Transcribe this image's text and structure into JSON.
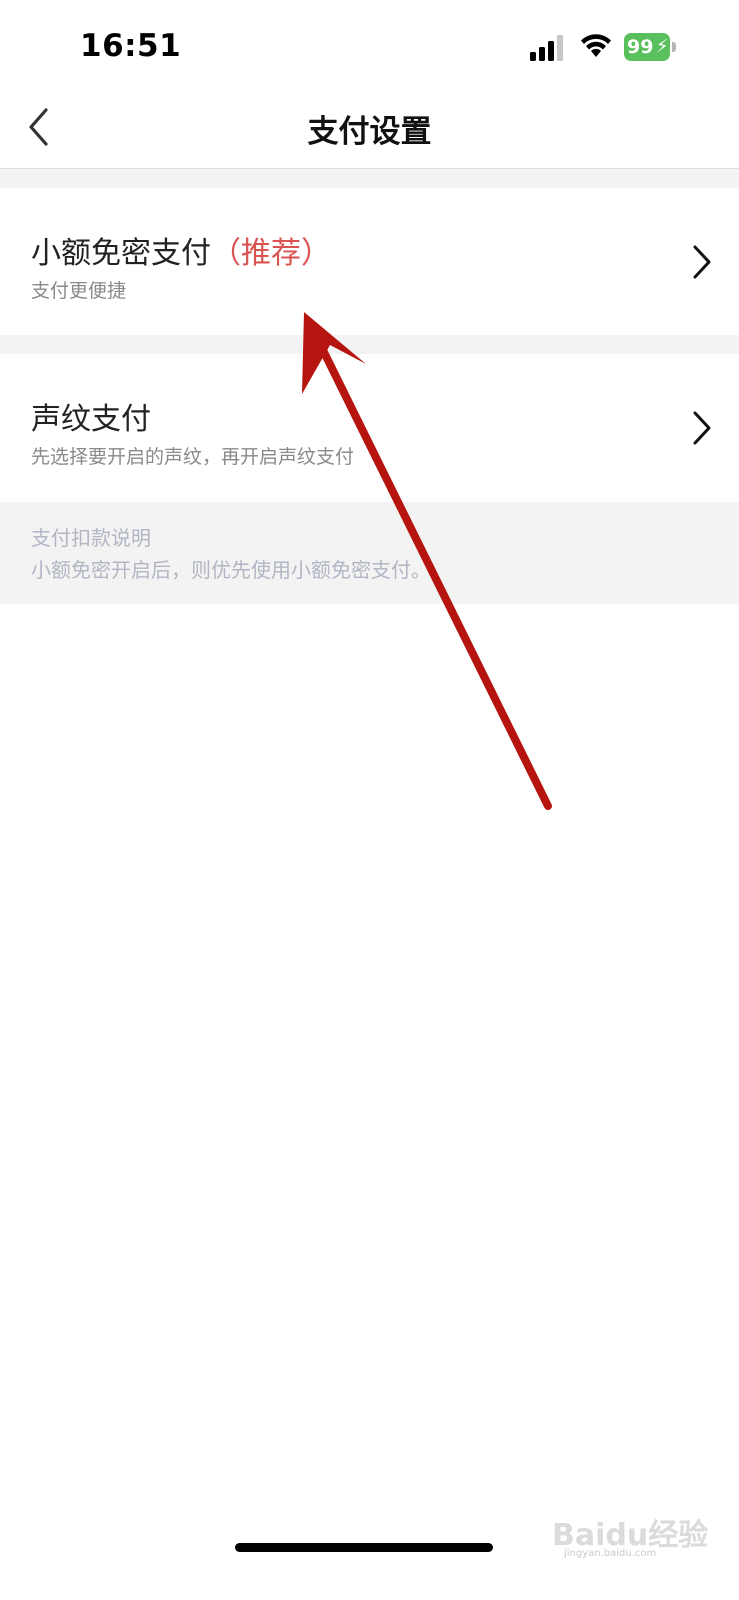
{
  "status_bar": {
    "time": "16:51",
    "battery_level": "99",
    "icons": [
      "signal-icon",
      "wifi-icon",
      "battery-charging-icon"
    ],
    "battery_color": "#5ac05d"
  },
  "nav": {
    "title": "支付设置",
    "back_icon": "back-chevron-icon"
  },
  "settings": [
    {
      "title": "小额免密支付",
      "tag": "（推荐）",
      "subtitle": "支付更便捷",
      "icon": "chevron-right-icon"
    },
    {
      "title": "声纹支付",
      "subtitle": "先选择要开启的声纹，再开启声纹支付",
      "icon": "chevron-right-icon"
    }
  ],
  "info": {
    "heading": "支付扣款说明",
    "text": "小额免密开启后，则优先使用小额免密支付。"
  },
  "annotation": {
    "type": "red-arrow",
    "color": "#b5140f",
    "points_to": "小额免密支付"
  },
  "watermark": {
    "text": "Baidu经验",
    "sub": "jingyan.baidu.com"
  },
  "colors": {
    "tag_red": "#d9534f",
    "section_gap": "#f3f3f3",
    "info_text": "#b2b6c4"
  }
}
